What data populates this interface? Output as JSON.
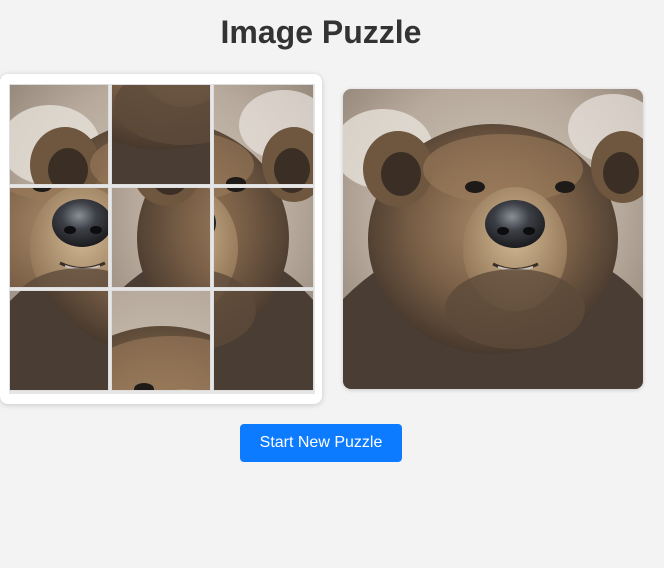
{
  "title": "Image Puzzle",
  "button": {
    "label": "Start New Puzzle"
  },
  "colors": {
    "accent": "#0d7bff",
    "background": "#f3f3f3",
    "title": "#333333"
  },
  "images": {
    "puzzle_image": "bear-face",
    "preview_image": "bear-face"
  },
  "puzzle": {
    "grid_size": 3,
    "tiles": [
      {
        "slot": 0,
        "piece": 0
      },
      {
        "slot": 1,
        "piece": 7
      },
      {
        "slot": 2,
        "piece": 2
      },
      {
        "slot": 3,
        "piece": 4
      },
      {
        "slot": 4,
        "piece": 3
      },
      {
        "slot": 5,
        "piece": 5
      },
      {
        "slot": 6,
        "piece": 6
      },
      {
        "slot": 7,
        "piece": 1
      },
      {
        "slot": 8,
        "piece": 8
      }
    ]
  }
}
